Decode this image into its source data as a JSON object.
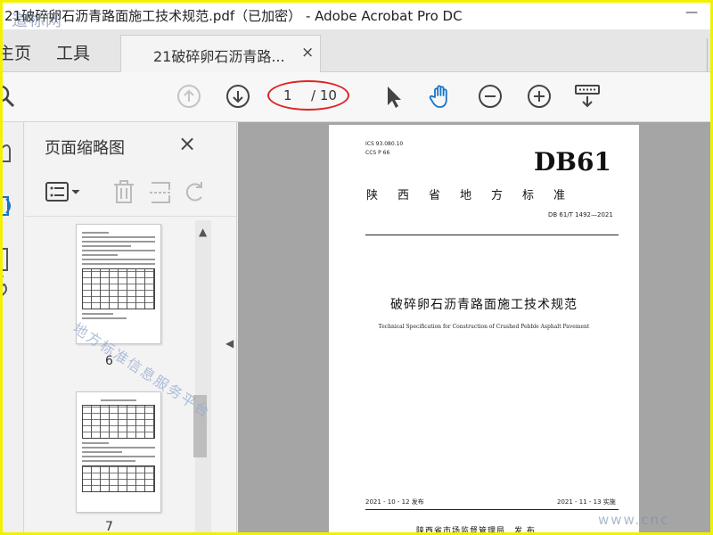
{
  "window": {
    "title": "21破碎卵石沥青路面施工技术规范.pdf（已加密） - Adobe Acrobat Pro DC",
    "minimize": "—",
    "watermark_logo": "道标网"
  },
  "tabs": {
    "home": "主页",
    "tools": "工具",
    "document": "21破碎卵石沥青路...",
    "close": "×"
  },
  "toolbar": {
    "current_page": "1",
    "total_pages": "/ 10",
    "highlight_color": "#e02424"
  },
  "thumbnails": {
    "title": "页面缩略图",
    "close": "×",
    "pages": [
      {
        "label": "6"
      },
      {
        "label": "7"
      }
    ]
  },
  "document": {
    "ics": "ICS 93.080.10",
    "ccs": "CCS P 66",
    "standard_mark": "DB61",
    "province": "陕西省地方标准",
    "code": "DB 61/T 1492—2021",
    "title_cn": "破碎卵石沥青路面施工技术规范",
    "title_en": "Technical Specification for Construction of Crushed Pebble Asphalt Pavement",
    "stamp": "地方标准信息服务平台",
    "issue_date": "2021 - 10 - 12 发布",
    "impl_date": "2021 - 11 - 13 实施",
    "publisher": "陕西省市场监督管理局　发 布",
    "site_watermark": "www.cnc"
  }
}
